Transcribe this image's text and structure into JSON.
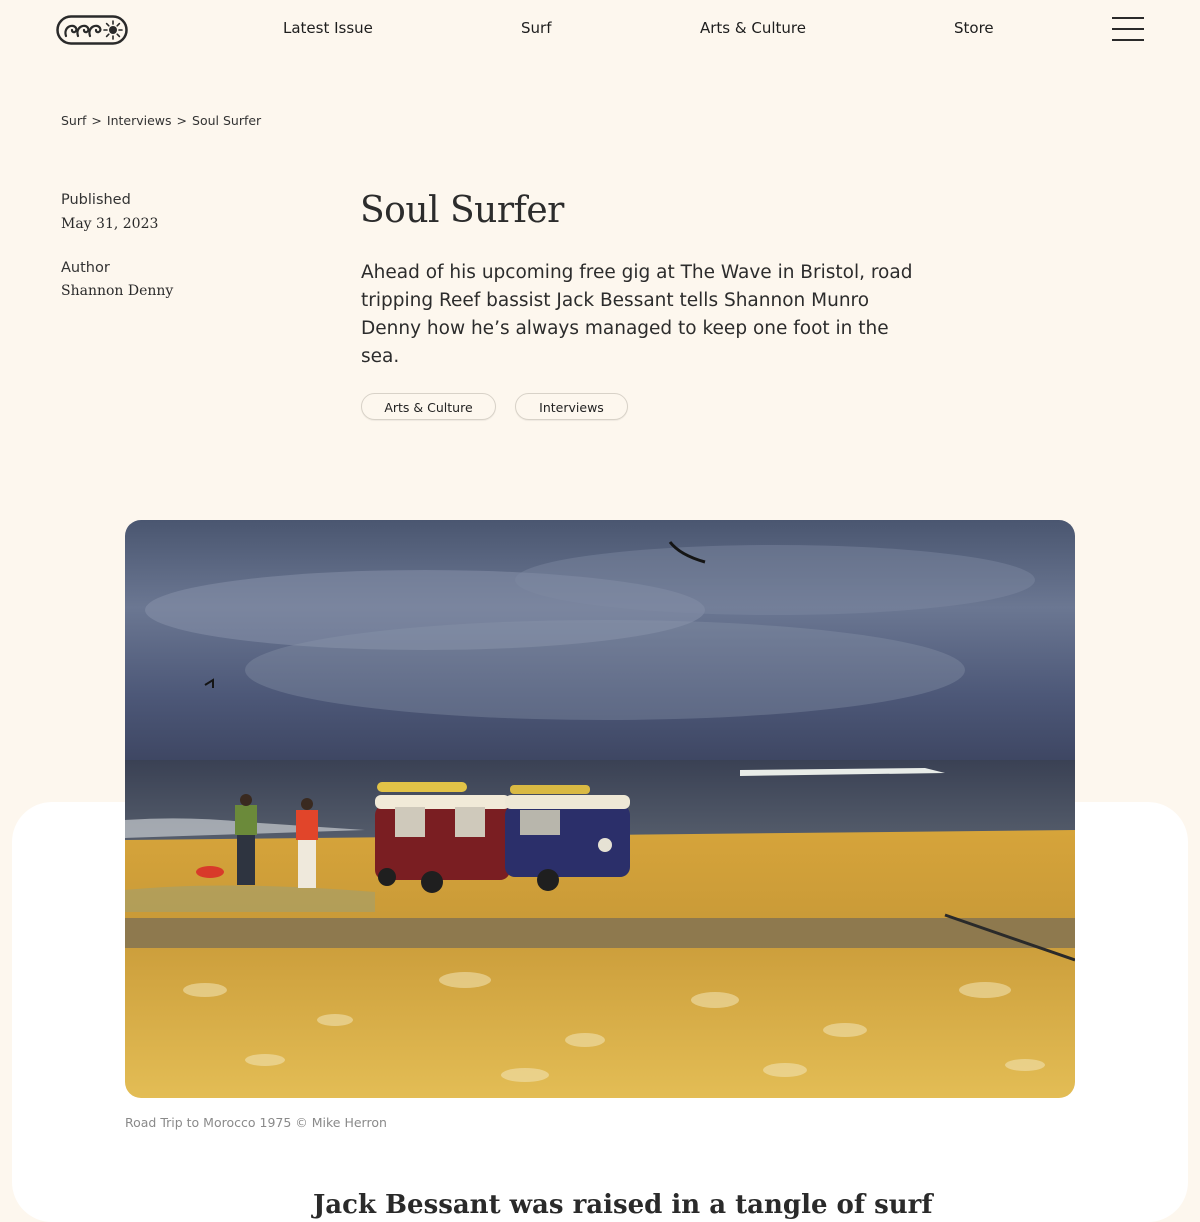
{
  "header": {
    "logo_icon": "wave-sun-logo",
    "nav": [
      {
        "label": "Latest Issue"
      },
      {
        "label": "Surf"
      },
      {
        "label": "Arts & Culture"
      },
      {
        "label": "Store"
      }
    ],
    "menu_icon": "hamburger-menu-icon"
  },
  "breadcrumb": {
    "items": [
      "Surf",
      "Interviews",
      "Soul Surfer"
    ],
    "separator": ">"
  },
  "meta": {
    "published_label": "Published",
    "published_value": "May 31, 2023",
    "author_label": "Author",
    "author_value": "Shannon Denny"
  },
  "article": {
    "title": "Soul Surfer",
    "standfirst": "Ahead of his upcoming free gig at The Wave in Bristol, road tripping Reef bassist Jack Bessant tells Shannon Munro Denny how he’s always managed to keep one foot in the sea.",
    "tags": [
      "Arts & Culture",
      "Interviews"
    ],
    "body_start": "Jack Bessant was raised in a tangle of surf"
  },
  "hero": {
    "caption": "Road Trip to Morocco 1975 © Mike Herron"
  },
  "colors": {
    "page_bg": "#fdf7ee",
    "text": "#2a2a2a",
    "caption": "#8a8a8a",
    "tag_border": "#d8d2c8"
  }
}
